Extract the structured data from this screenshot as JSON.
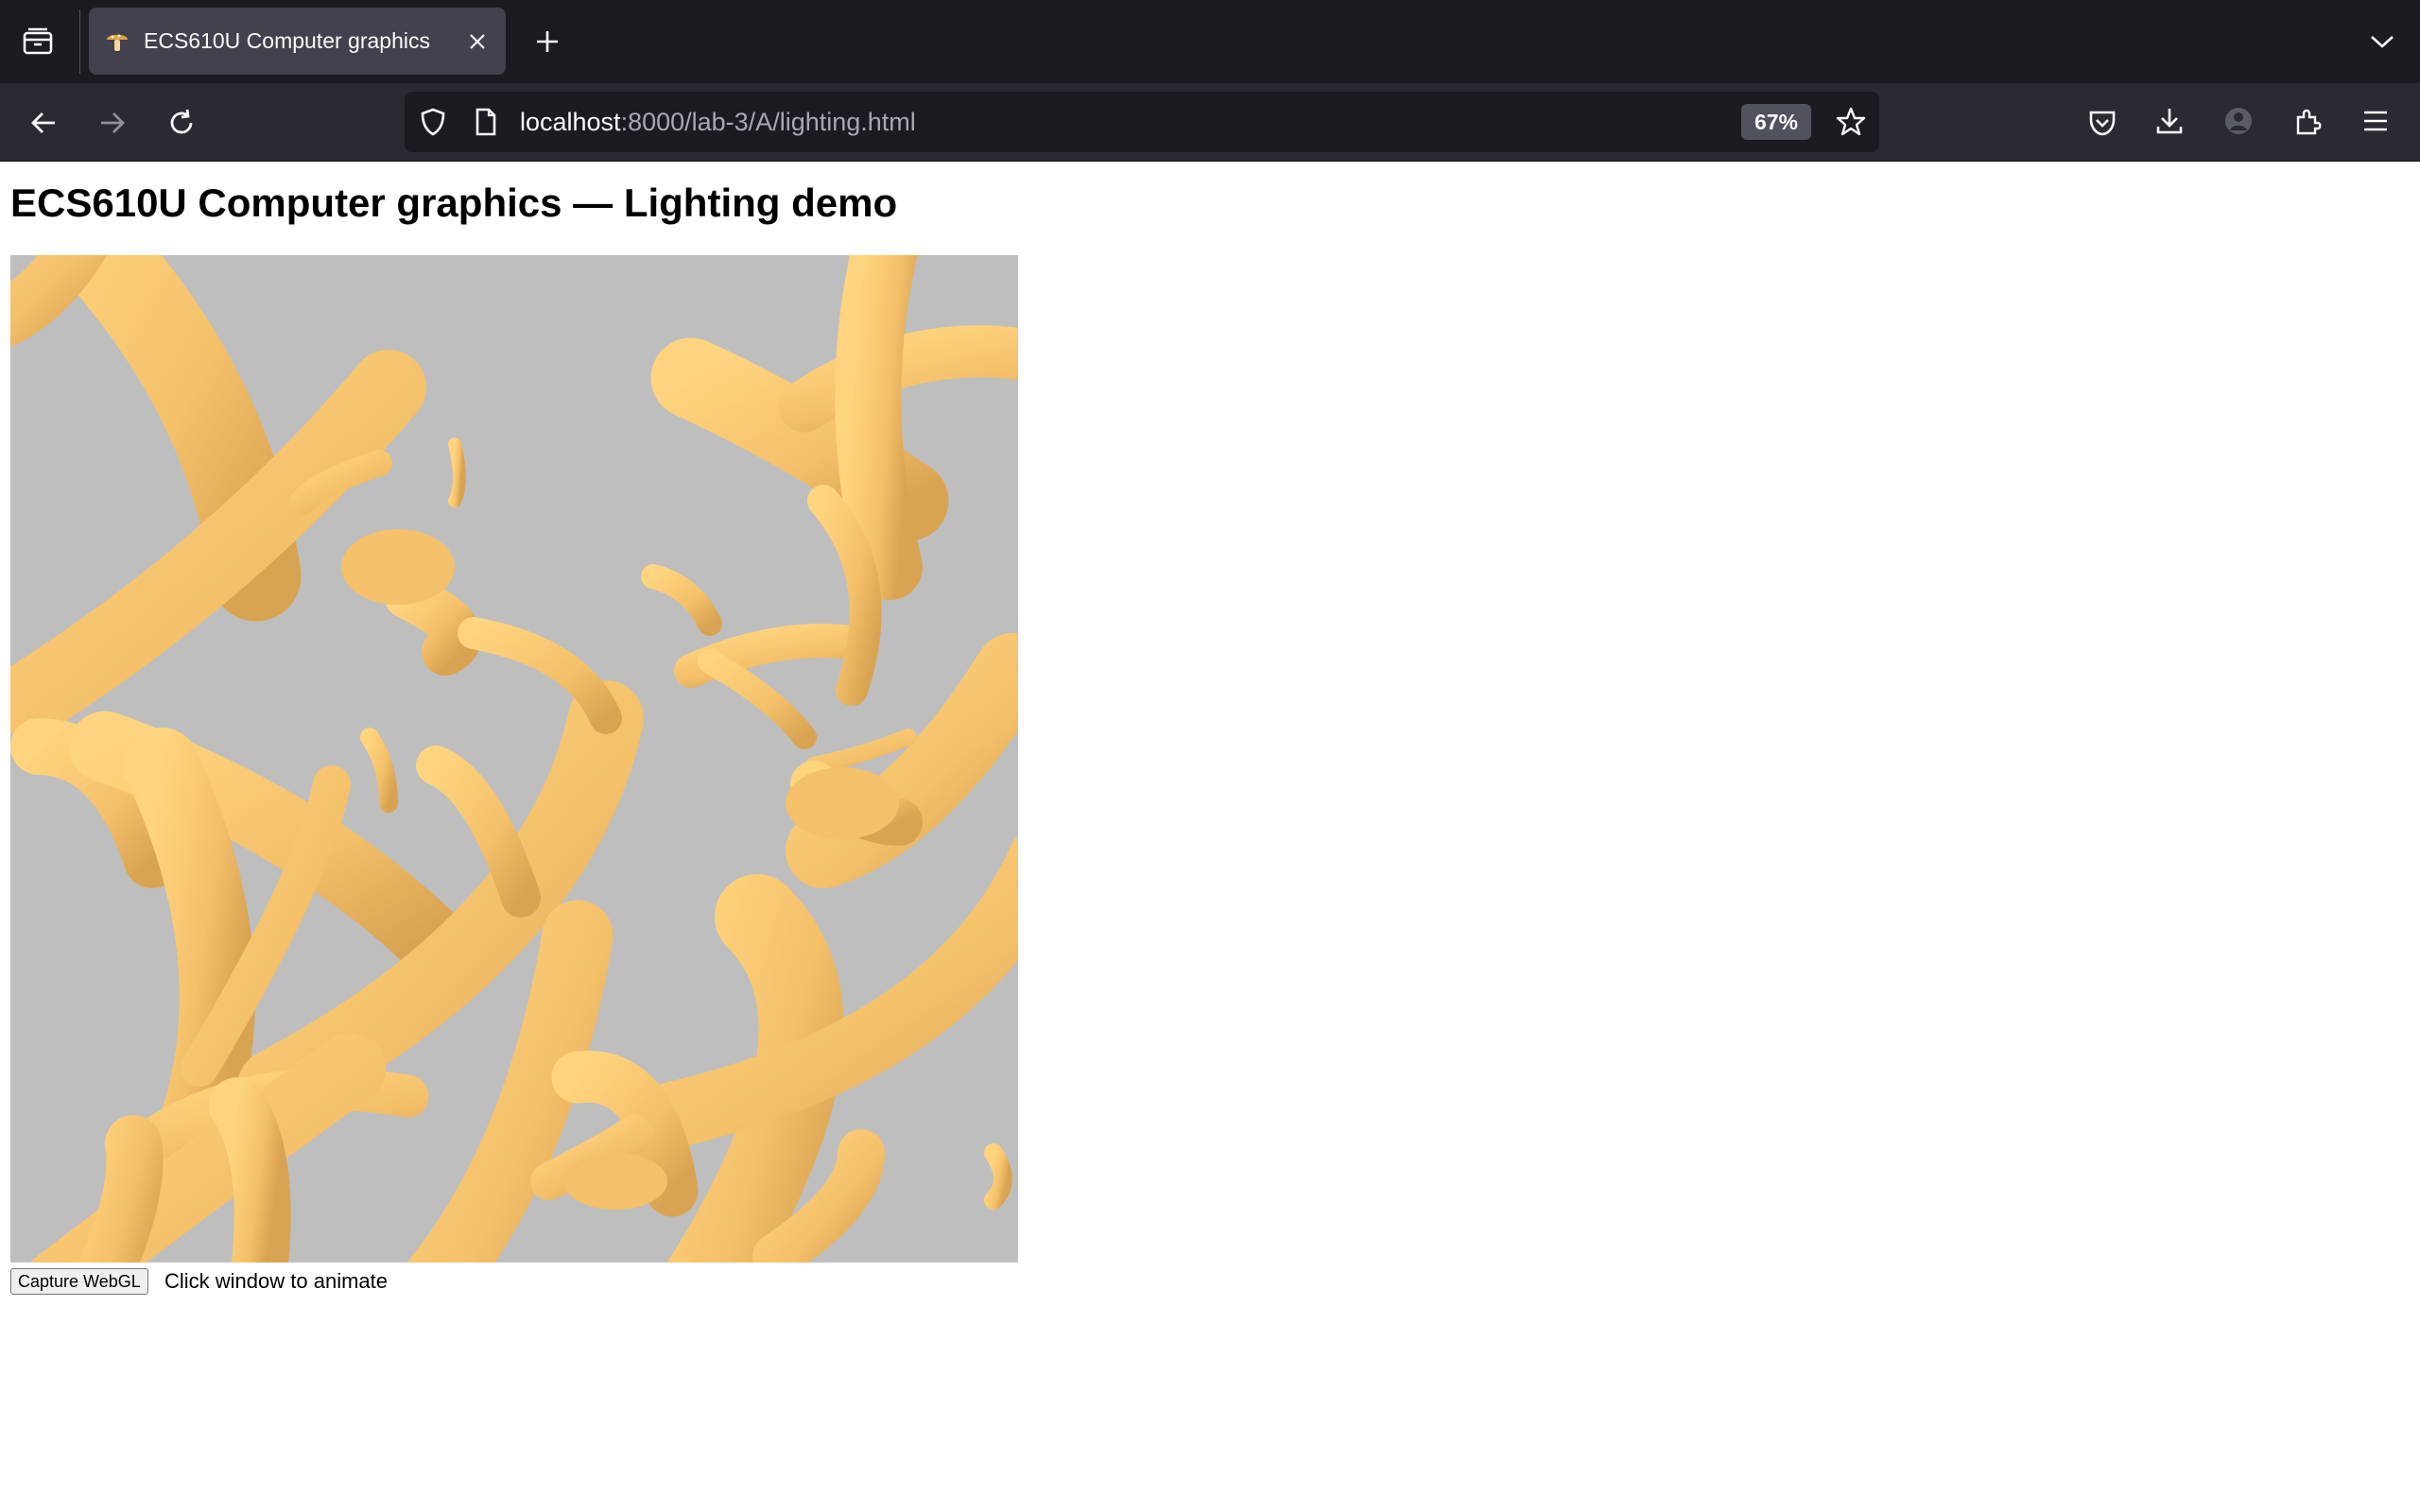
{
  "browser": {
    "tab": {
      "title": "ECS610U Computer graphics",
      "favicon": "mushroom-icon"
    },
    "url": {
      "host": "localhost",
      "rest": ":8000/lab-3/A/lighting.html"
    },
    "zoom": "67%",
    "colors": {
      "tabbar": "#1c1b22",
      "navbar": "#2b2a33",
      "active_tab": "#42414d",
      "urlbar": "#1c1b22"
    },
    "icons": [
      "tab-overview-icon",
      "close-icon",
      "new-tab-icon",
      "list-all-tabs-icon",
      "back-arrow-icon",
      "forward-arrow-icon",
      "reload-icon",
      "shield-icon",
      "page-icon",
      "bookmark-star-icon",
      "pocket-icon",
      "download-icon",
      "account-icon",
      "extensions-icon",
      "menu-icon"
    ]
  },
  "page": {
    "title": "ECS610U Computer graphics — Lighting demo",
    "canvas": {
      "background": "#bebebe",
      "object_color": "#f5c26b"
    },
    "capture_button": "Capture WebGL",
    "hint": "Click window to animate"
  }
}
